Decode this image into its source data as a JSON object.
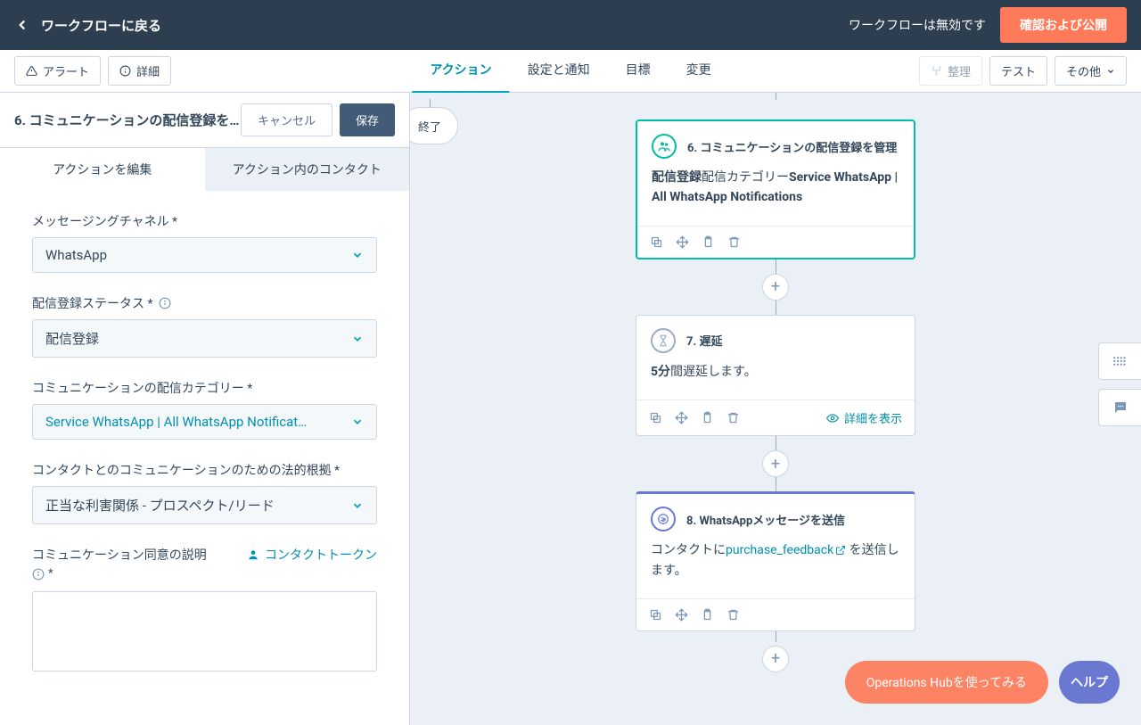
{
  "topbar": {
    "back": "ワークフローに戻る",
    "status": "ワークフローは無効です",
    "publish": "確認および公開"
  },
  "secondbar": {
    "alert": "アラート",
    "detail": "詳細",
    "tabs": {
      "actions": "アクション",
      "settings": "設定と通知",
      "goal": "目標",
      "change": "変更"
    },
    "organize": "整理",
    "test": "テスト",
    "more": "その他"
  },
  "panel": {
    "title": "6. コミュニケーションの配信登録を…",
    "cancel": "キャンセル",
    "save": "保存",
    "tab_edit": "アクションを編集",
    "tab_contacts": "アクション内のコンタクト",
    "field_channel_label": "メッセージングチャネル *",
    "field_channel_value": "WhatsApp",
    "field_status_label": "配信登録ステータス *",
    "field_status_value": "配信登録",
    "field_category_label": "コミュニケーションの配信カテゴリー *",
    "field_category_value": "Service WhatsApp | All WhatsApp Notificat…",
    "field_legal_label": "コンタクトとのコミュニケーションのための法的根拠 *",
    "field_legal_value": "正当な利害関係 - プロスペクト/リード",
    "field_consent_label": "コミュニケーション同意の説明",
    "field_consent_req": "*",
    "contact_token": "コンタクトトークン"
  },
  "canvas": {
    "end": "終了",
    "card6": {
      "title": "6. コミュニケーションの配信登録を管理",
      "body_prefix": "配信登録",
      "body_mid": "配信カテゴリー",
      "body_bold": "Service WhatsApp | All WhatsApp Notifications"
    },
    "card7": {
      "title": "7. 遅延",
      "body_bold": "5分",
      "body_rest": "間遅延します。",
      "detail": "詳細を表示"
    },
    "card8": {
      "title": "8. WhatsAppメッセージを送信",
      "body_pre": "コンタクトに",
      "body_link": "purchase_feedback",
      "body_post": " を送信します。"
    }
  },
  "float": {
    "ops": "Operations Hubを使ってみる",
    "help": "ヘルプ"
  }
}
